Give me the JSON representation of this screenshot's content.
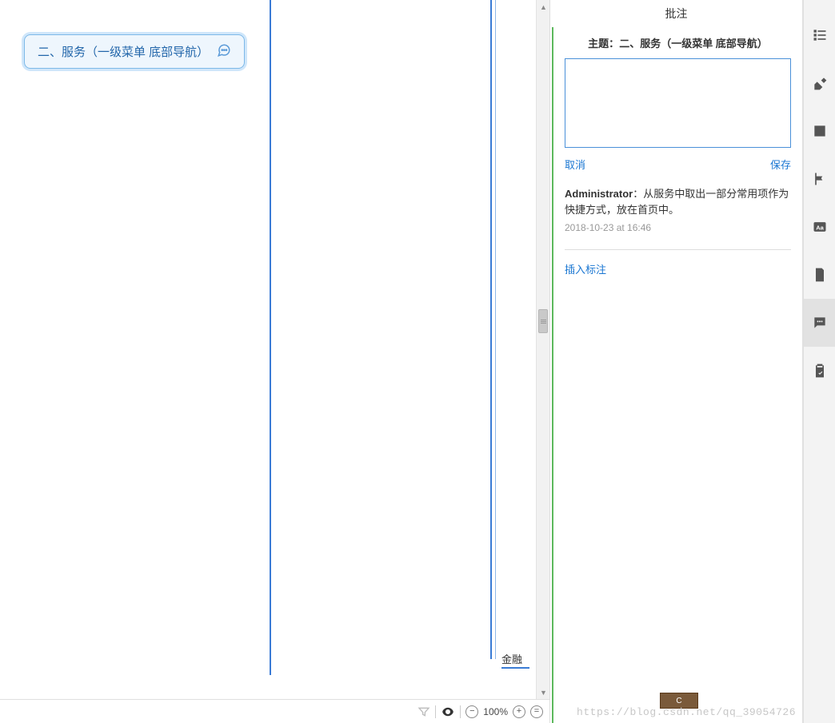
{
  "canvas": {
    "node_label": "二、服务（一级菜单 底部导航）",
    "tail_label": "金融"
  },
  "statusbar": {
    "zoom": "100%"
  },
  "annotation_panel": {
    "title": "批注",
    "topic_prefix": "主题：",
    "topic": "二、服务（一级菜单 底部导航）",
    "cancel": "取消",
    "save": "保存",
    "comment": {
      "author": "Administrator",
      "sep": "：",
      "text": "从服务中取出一部分常用项作为快捷方式，放在首页中。",
      "timestamp": "2018-10-23 at 16:46"
    },
    "insert_label": "插入标注"
  },
  "sidebar_tools": [
    {
      "name": "outline-icon"
    },
    {
      "name": "format-icon"
    },
    {
      "name": "image-icon"
    },
    {
      "name": "flag-icon"
    },
    {
      "name": "text-aa-icon"
    },
    {
      "name": "document-icon"
    },
    {
      "name": "comments-icon"
    },
    {
      "name": "clipboard-icon"
    }
  ],
  "watermark": "https://blog.csdn.net/qq_39054726"
}
